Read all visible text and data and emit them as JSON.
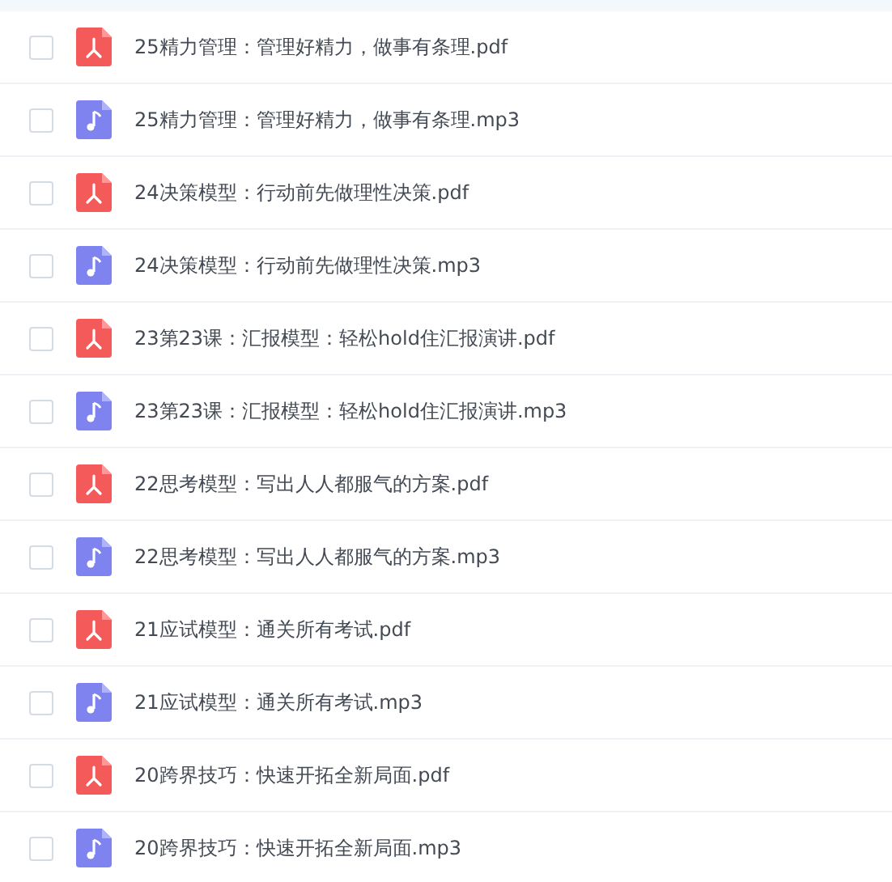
{
  "files": [
    {
      "name": "25精力管理：管理好精力，做事有条理.pdf",
      "kind": "pdf",
      "checked": false
    },
    {
      "name": "25精力管理：管理好精力，做事有条理.mp3",
      "kind": "audio",
      "checked": false
    },
    {
      "name": "24决策模型：行动前先做理性决策.pdf",
      "kind": "pdf",
      "checked": false
    },
    {
      "name": "24决策模型：行动前先做理性决策.mp3",
      "kind": "audio",
      "checked": false
    },
    {
      "name": "23第23课：汇报模型：轻松hold住汇报演讲.pdf",
      "kind": "pdf",
      "checked": false
    },
    {
      "name": "23第23课：汇报模型：轻松hold住汇报演讲.mp3",
      "kind": "audio",
      "checked": false
    },
    {
      "name": "22思考模型：写出人人都服气的方案.pdf",
      "kind": "pdf",
      "checked": false
    },
    {
      "name": "22思考模型：写出人人都服气的方案.mp3",
      "kind": "audio",
      "checked": false
    },
    {
      "name": "21应试模型：通关所有考试.pdf",
      "kind": "pdf",
      "checked": false
    },
    {
      "name": "21应试模型：通关所有考试.mp3",
      "kind": "audio",
      "checked": false
    },
    {
      "name": "20跨界技巧：快速开拓全新局面.pdf",
      "kind": "pdf",
      "checked": false
    },
    {
      "name": "20跨界技巧：快速开拓全新局面.mp3",
      "kind": "audio",
      "checked": false
    }
  ]
}
